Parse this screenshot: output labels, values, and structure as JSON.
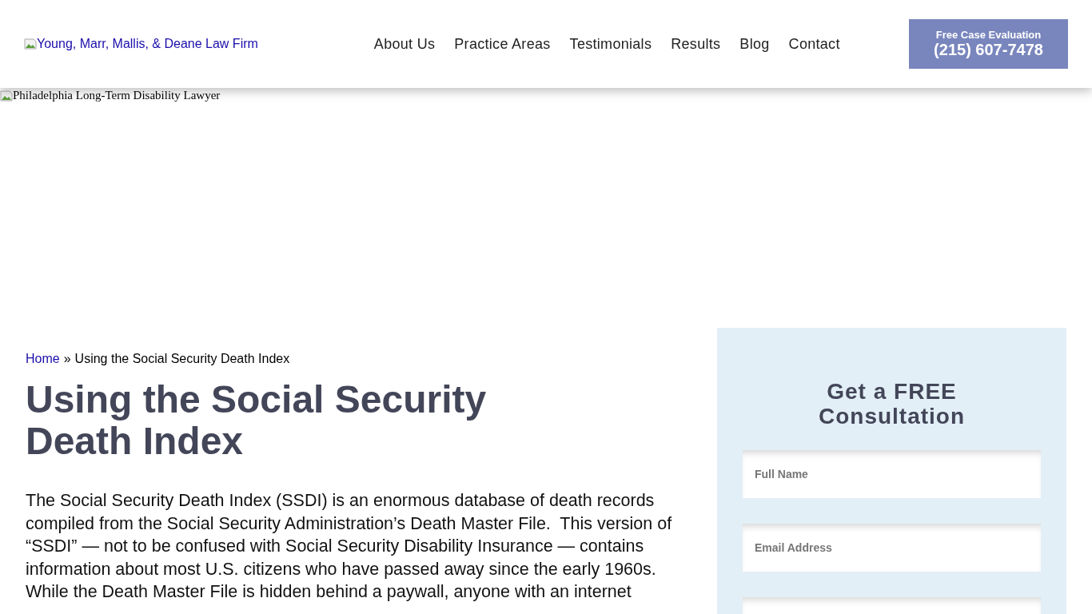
{
  "header": {
    "logo_alt": "Young, Marr, Mallis, & Deane Law Firm",
    "nav": [
      "About Us",
      "Practice Areas",
      "Testimonials",
      "Results",
      "Blog",
      "Contact"
    ],
    "cta": {
      "label": "Free Case Evaluation",
      "phone": "(215) 607-7478"
    }
  },
  "hero": {
    "image_alt": "Philadelphia Long-Term Disability Lawyer"
  },
  "breadcrumb": {
    "home": "Home",
    "separator": "»",
    "current": "Using the Social Security Death Index"
  },
  "article": {
    "title": "Using the Social Security Death Index",
    "paragraph": "The Social Security Death Index (SSDI) is an enormous database of death records compiled from the Social Security Administration’s Death Master File.  This version of “SSDI” — not to be confused with Social Security Disability Insurance — contains information about most U.S. citizens who have passed away since the early 1960s.  While the Death Master File is hidden behind a paywall, anyone with an internet"
  },
  "sidebar": {
    "title": "Get a FREE Consultation",
    "fields": [
      {
        "placeholder": "Full Name"
      },
      {
        "placeholder": "Email Address"
      }
    ]
  }
}
